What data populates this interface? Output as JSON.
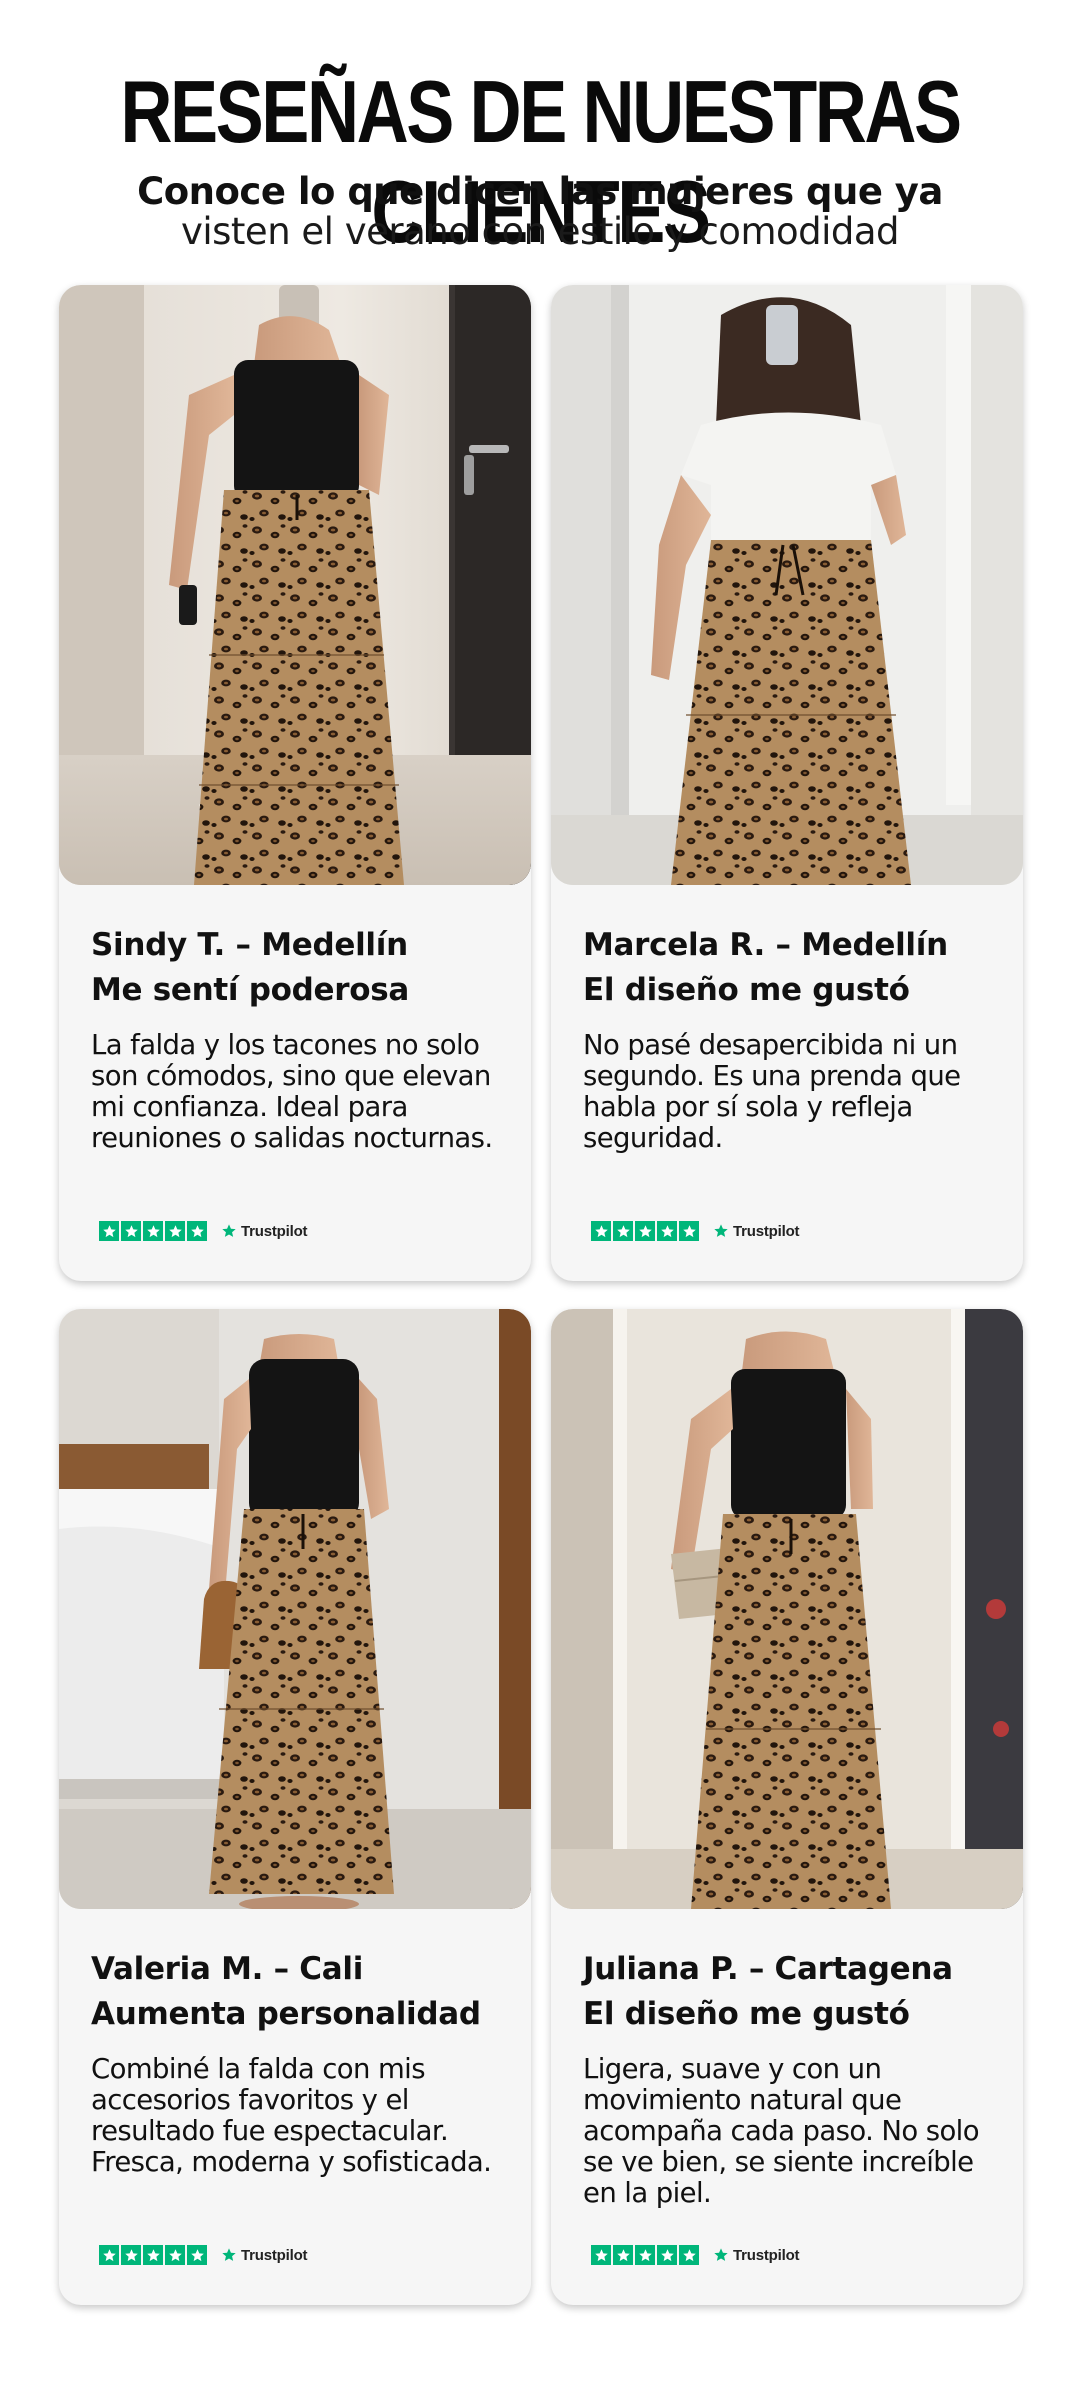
{
  "header": {
    "title": "RESEÑAS DE NUESTRAS CLIENTES",
    "subtitle_bold": "Conoce lo que dicen las mujeres que ya",
    "subtitle_light": "visten el verano con estilo y comodidad"
  },
  "colors": {
    "trustpilot_green": "#00b67a",
    "card_background": "#f6f6f6",
    "leopard_base": "#b08a5e"
  },
  "reviews": [
    {
      "name": "Sindy T. – Medellín",
      "headline": "Me sentí poderosa",
      "text": "La falda y los tacones no solo son cómodos, sino que elevan mi confianza. Ideal para reuniones o salidas nocturnas.",
      "rating": 5,
      "rating_source": "Trustpilot",
      "photo_icon": "woman-black-strapless-top-leopard-skirt-photo"
    },
    {
      "name": "Marcela R. – Medellín",
      "headline": "El diseño me gustó",
      "text": "No pasé desapercibida ni un segundo. Es una prenda que habla por sí sola y refleja seguridad.",
      "rating": 5,
      "rating_source": "Trustpilot",
      "photo_icon": "woman-white-tee-leopard-skirt-photo"
    },
    {
      "name": "Valeria M. – Cali",
      "headline": "Aumenta personalidad",
      "text": "Combiné la falda con mis accesorios favoritos y el resultado fue espectacular. Fresca, moderna y sofisticada.",
      "rating": 5,
      "rating_source": "Trustpilot",
      "photo_icon": "woman-black-cami-leopard-skirt-bedroom-photo"
    },
    {
      "name": "Juliana P. – Cartagena",
      "headline": "El diseño me gustó",
      "text": "Ligera, suave y con un movimiento natural que acompaña cada paso. No solo se ve bien, se siente increíble en la piel.",
      "rating": 5,
      "rating_source": "Trustpilot",
      "photo_icon": "woman-black-strapless-leopard-skirt-clutch-photo"
    }
  ]
}
